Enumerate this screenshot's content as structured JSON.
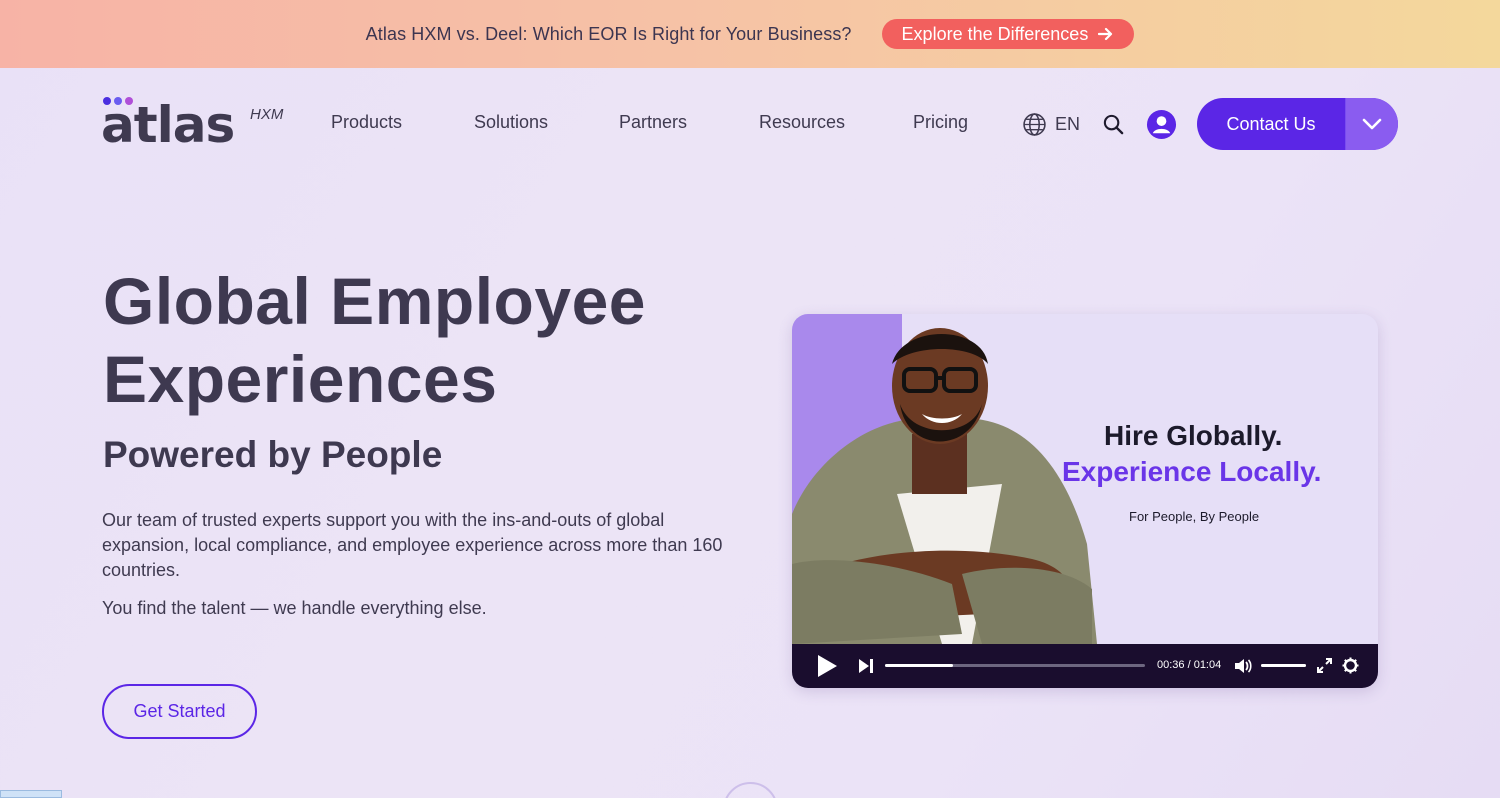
{
  "promo": {
    "text": "Atlas HXM vs. Deel: Which EOR Is Right for Your Business?",
    "cta_label": "Explore the Differences",
    "cta_icon": "arrow-right-icon"
  },
  "header": {
    "logo_text": "atlas",
    "logo_sup": "HXM",
    "logo_dot_colors": [
      "#5b26e6",
      "#6a5cf0",
      "#b04fd8"
    ],
    "nav": [
      "Products",
      "Solutions",
      "Partners",
      "Resources",
      "Pricing"
    ],
    "language": "EN",
    "icons": {
      "language": "globe-icon",
      "search": "search-icon",
      "account": "user-icon"
    },
    "contact_label": "Contact Us",
    "contact_menu_icon": "chevron-down-icon"
  },
  "hero": {
    "title_line1": "Global Employee",
    "title_line2": "Experiences",
    "subtitle": "Powered by People",
    "body": "Our team of trusted experts support you with the ins-and-outs of global expansion, local compliance, and employee experience across more than 160 countries.",
    "body2": "You find the talent — we handle everything else.",
    "cta_label": "Get Started"
  },
  "video": {
    "headline1": "Hire Globally.",
    "headline2": "Experience Locally.",
    "tagline": "For People, By People",
    "current_time": "00:36",
    "duration": "01:04",
    "time_display": "00:36 / 01:04",
    "progress_fraction": 0.26,
    "volume_fraction": 1.0,
    "icons": [
      "play-icon",
      "skip-next-icon",
      "volume-icon",
      "fullscreen-icon",
      "settings-icon"
    ]
  },
  "colors": {
    "accent": "#5b26e6",
    "promo_button": "#f2605e",
    "heading": "#3e3950"
  }
}
